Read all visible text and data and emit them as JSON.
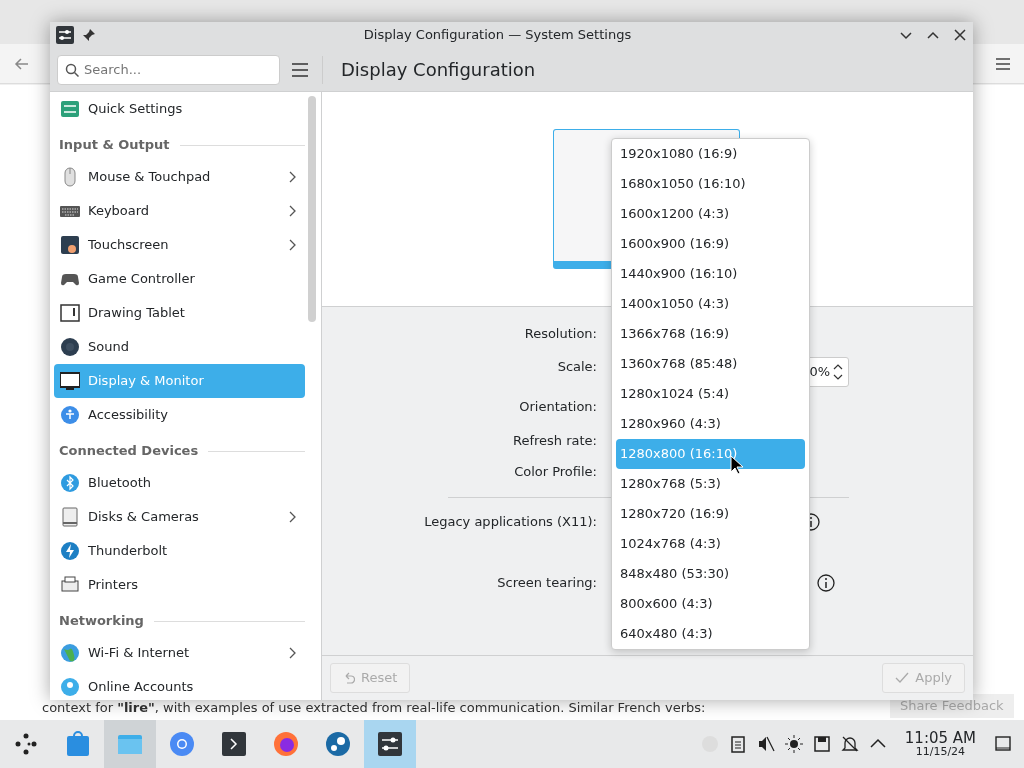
{
  "browser": {
    "text": "context for **\"lire\"**, with examples of use extracted from real-life communication. Similar French verbs:",
    "feedback_button": "Share Feedback"
  },
  "window": {
    "title": "Display Configuration — System Settings",
    "search": {
      "placeholder": "Search..."
    },
    "page_title": "Display Configuration",
    "sidebar": {
      "items": [
        {
          "kind": "item",
          "label": "Quick Settings",
          "selected": false,
          "expandable": false
        },
        {
          "kind": "header",
          "label": "Input & Output"
        },
        {
          "kind": "item",
          "label": "Mouse & Touchpad",
          "selected": false,
          "expandable": true
        },
        {
          "kind": "item",
          "label": "Keyboard",
          "selected": false,
          "expandable": true
        },
        {
          "kind": "item",
          "label": "Touchscreen",
          "selected": false,
          "expandable": true
        },
        {
          "kind": "item",
          "label": "Game Controller",
          "selected": false,
          "expandable": false
        },
        {
          "kind": "item",
          "label": "Drawing Tablet",
          "selected": false,
          "expandable": false
        },
        {
          "kind": "item",
          "label": "Sound",
          "selected": false,
          "expandable": false
        },
        {
          "kind": "item",
          "label": "Display & Monitor",
          "selected": true,
          "expandable": false
        },
        {
          "kind": "item",
          "label": "Accessibility",
          "selected": false,
          "expandable": false
        },
        {
          "kind": "header",
          "label": "Connected Devices"
        },
        {
          "kind": "item",
          "label": "Bluetooth",
          "selected": false,
          "expandable": false
        },
        {
          "kind": "item",
          "label": "Disks & Cameras",
          "selected": false,
          "expandable": true
        },
        {
          "kind": "item",
          "label": "Thunderbolt",
          "selected": false,
          "expandable": false
        },
        {
          "kind": "item",
          "label": "Printers",
          "selected": false,
          "expandable": false
        },
        {
          "kind": "header",
          "label": "Networking"
        },
        {
          "kind": "item",
          "label": "Wi-Fi & Internet",
          "selected": false,
          "expandable": true
        },
        {
          "kind": "item",
          "label": "Online Accounts",
          "selected": false,
          "expandable": false
        }
      ]
    },
    "form": {
      "rows": [
        {
          "label": "Resolution:"
        },
        {
          "label": "Scale:",
          "value": "0%"
        },
        {
          "label": "Orientation:"
        },
        {
          "label": "Refresh rate:"
        },
        {
          "label": "Color Profile:"
        },
        {
          "label": "Legacy applications (X11):",
          "info": true
        },
        {
          "label": "Screen tearing:",
          "info": true
        }
      ]
    },
    "resolution_menu": {
      "items": [
        {
          "label": "1920x1080 (16:9)",
          "selected": false
        },
        {
          "label": "1680x1050 (16:10)",
          "selected": false
        },
        {
          "label": "1600x1200 (4:3)",
          "selected": false
        },
        {
          "label": "1600x900 (16:9)",
          "selected": false
        },
        {
          "label": "1440x900 (16:10)",
          "selected": false
        },
        {
          "label": "1400x1050 (4:3)",
          "selected": false
        },
        {
          "label": "1366x768 (16:9)",
          "selected": false
        },
        {
          "label": "1360x768 (85:48)",
          "selected": false
        },
        {
          "label": "1280x1024 (5:4)",
          "selected": false
        },
        {
          "label": "1280x960 (4:3)",
          "selected": false
        },
        {
          "label": "1280x800 (16:10)",
          "selected": true
        },
        {
          "label": "1280x768 (5:3)",
          "selected": false
        },
        {
          "label": "1280x720 (16:9)",
          "selected": false
        },
        {
          "label": "1024x768 (4:3)",
          "selected": false
        },
        {
          "label": "848x480 (53:30)",
          "selected": false
        },
        {
          "label": "800x600 (4:3)",
          "selected": false
        },
        {
          "label": "640x480 (4:3)",
          "selected": false
        }
      ]
    },
    "footer": {
      "reset": "Reset",
      "apply": "Apply",
      "disabled": true
    }
  },
  "taskbar": {
    "time": "11:05 AM",
    "date": "11/15/24"
  }
}
